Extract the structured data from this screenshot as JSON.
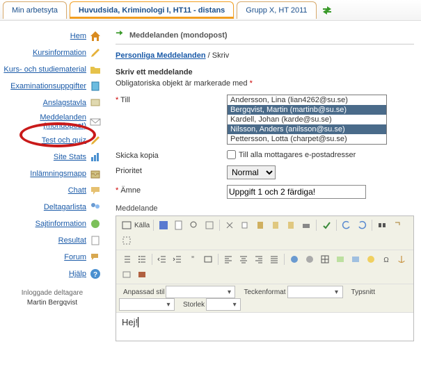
{
  "tabs": {
    "t0": "Min arbetsyta",
    "t1": "Huvudsida, Kriminologi I, HT11 - distans",
    "t2": "Grupp X, HT 2011"
  },
  "nav": {
    "hem": "Hem",
    "kursinfo": "Kursinformation",
    "kursmat": "Kurs- och studiematerial",
    "exam": "Examinationsuppgifter",
    "anslag": "Anslagstavla",
    "medd1": "Meddelanden",
    "medd2": "(mondopost)",
    "quiz": "Test och quiz",
    "stats": "Site Stats",
    "inlam": "Inlämningsmapp",
    "chatt": "Chatt",
    "deltag": "Deltagarlista",
    "sajt": "Sajtinformation",
    "resultat": "Resultat",
    "forum": "Forum",
    "hjalp": "Hjälp"
  },
  "loggedin": {
    "title": "Inloggade deltagare",
    "name": "Martin Bergqvist"
  },
  "page": {
    "title": "Meddelanden (mondopost)"
  },
  "breadcrumb": {
    "link": "Personliga Meddelanden",
    "sep": " / ",
    "current": "Skriv"
  },
  "form": {
    "heading": "Skriv ett meddelande",
    "req_note": "Obligatoriska objekt är markerade med ",
    "to_label": "Till",
    "recipients": [
      "Andersson, Lina (lian4262@su.se)",
      "Bergqvist, Martin (martinb@su.se)",
      "Kardell, Johan (karde@su.se)",
      "Nilsson, Anders (anilsson@su.se)",
      "Pettersson, Lotta (charpet@su.se)"
    ],
    "cc_label": "Skicka kopia",
    "cc_check": "Till alla mottagares e-postadresser",
    "prio_label": "Prioritet",
    "prio_value": "Normal",
    "subj_label": "Ämne",
    "subj_value": "Uppgift 1 och 2 färdiga!",
    "msg_label": "Meddelande",
    "body": "Hej!"
  },
  "editor": {
    "source": "Källa",
    "style_lbl": "Anpassad stil",
    "format_lbl": "Teckenformat",
    "font_lbl": "Typsnitt",
    "size_lbl": "Storlek"
  }
}
